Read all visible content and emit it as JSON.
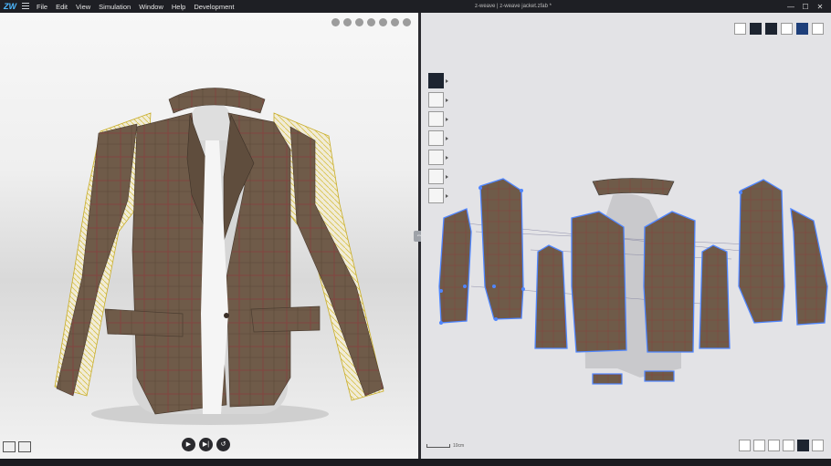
{
  "app": {
    "logo_text": "ZW",
    "menu": [
      "File",
      "Edit",
      "View",
      "Simulation",
      "Window",
      "Help",
      "Development"
    ],
    "document_title": "z-weave | z-weave jacket.zfab *",
    "window_controls": [
      "—",
      "☐",
      "✕"
    ]
  },
  "viewport3d": {
    "playback_controls": [
      "play",
      "step-forward",
      "reset"
    ]
  },
  "viewport2d": {
    "scale_label": "10cm"
  },
  "colors": {
    "fabric": "#6f5b49",
    "fabric_check": "#8a3d3d",
    "seam_lines": "#d8c24a",
    "pattern_outline": "#4f86ff",
    "avatar": "#d8d8d8"
  }
}
